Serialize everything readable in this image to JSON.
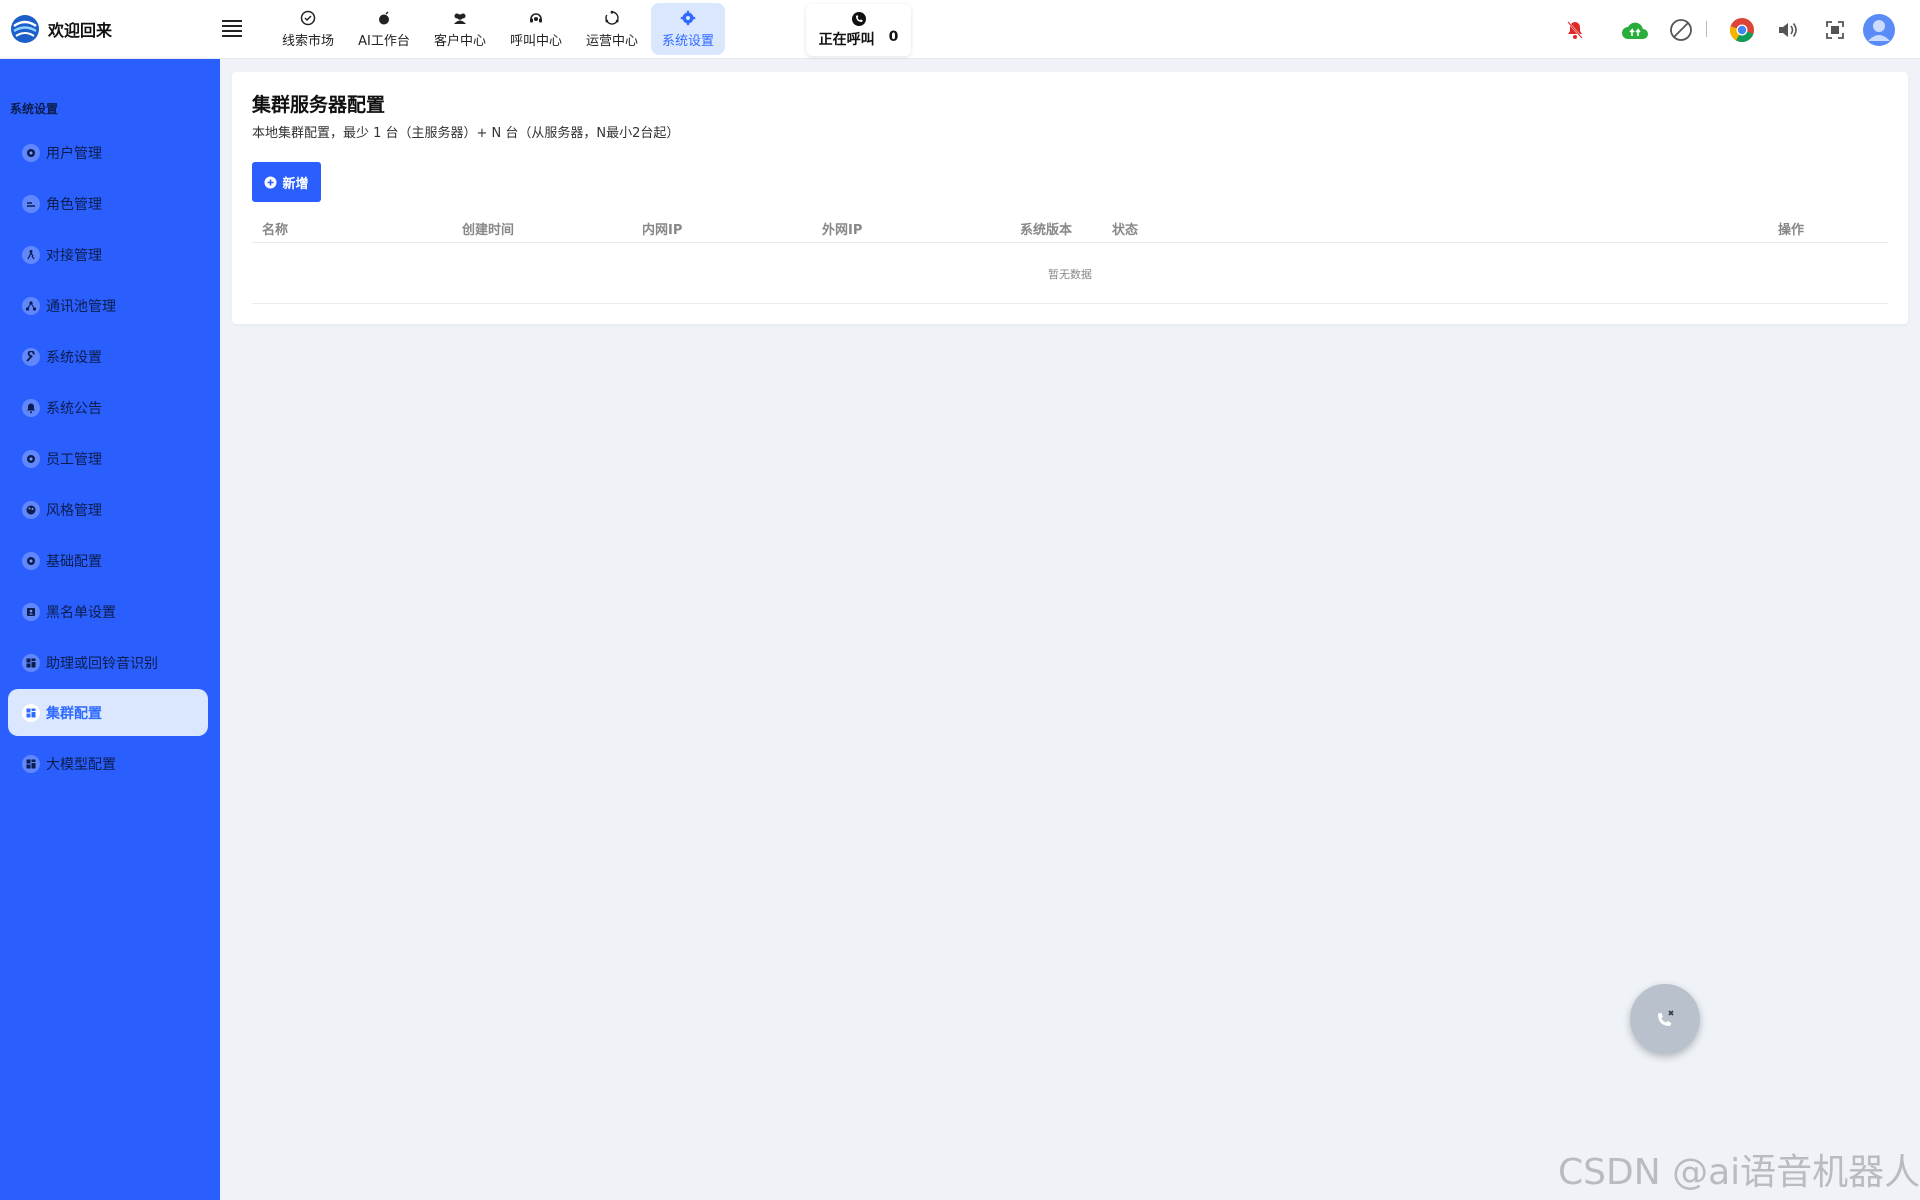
{
  "brand": {
    "title": "欢迎回来"
  },
  "topnav": [
    {
      "label": "线索市场",
      "icon": "check-circle-icon"
    },
    {
      "label": "AI工作台",
      "icon": "bomb-icon"
    },
    {
      "label": "客户中心",
      "icon": "users-icon"
    },
    {
      "label": "呼叫中心",
      "icon": "headset-icon"
    },
    {
      "label": "运营中心",
      "icon": "recycle-icon"
    },
    {
      "label": "系统设置",
      "icon": "gear-icon",
      "active": true
    }
  ],
  "calling": {
    "label": "正在呼叫",
    "count": "0"
  },
  "header_icons": [
    "bell-off-icon",
    "cloud-upload-icon",
    "ban-icon",
    "chrome-icon",
    "volume-icon",
    "fullscreen-icon",
    "avatar"
  ],
  "sidebar": {
    "section": "系统设置",
    "items": [
      {
        "label": "用户管理",
        "icon": "gear-icon"
      },
      {
        "label": "角色管理",
        "icon": "role-icon"
      },
      {
        "label": "对接管理",
        "icon": "person-run-icon"
      },
      {
        "label": "通讯池管理",
        "icon": "network-icon"
      },
      {
        "label": "系统设置",
        "icon": "wrench-icon"
      },
      {
        "label": "系统公告",
        "icon": "bell-icon"
      },
      {
        "label": "员工管理",
        "icon": "gear-icon"
      },
      {
        "label": "风格管理",
        "icon": "palette-icon"
      },
      {
        "label": "基础配置",
        "icon": "gear-icon"
      },
      {
        "label": "黑名单设置",
        "icon": "contact-card-icon"
      },
      {
        "label": "助理或回铃音识别",
        "icon": "dashboard-icon"
      },
      {
        "label": "集群配置",
        "icon": "dashboard-icon",
        "active": true
      },
      {
        "label": "大模型配置",
        "icon": "dashboard-icon"
      }
    ]
  },
  "main": {
    "title": "集群服务器配置",
    "subtitle": "本地集群配置，最少 1 台（主服务器）+ N 台（从服务器，N最小2台起）",
    "add_label": "新增",
    "columns": [
      "名称",
      "创建时间",
      "内网IP",
      "外网IP",
      "系统版本",
      "状态",
      "操作"
    ],
    "empty_text": "暂无数据"
  },
  "watermark": "CSDN @ai语音机器人",
  "colors": {
    "primary": "#2b5ffd",
    "active_bg": "#dbe7ff",
    "active_text": "#2f6bff",
    "alert_red": "#e02a2a",
    "cloud_green": "#2aae3b"
  }
}
